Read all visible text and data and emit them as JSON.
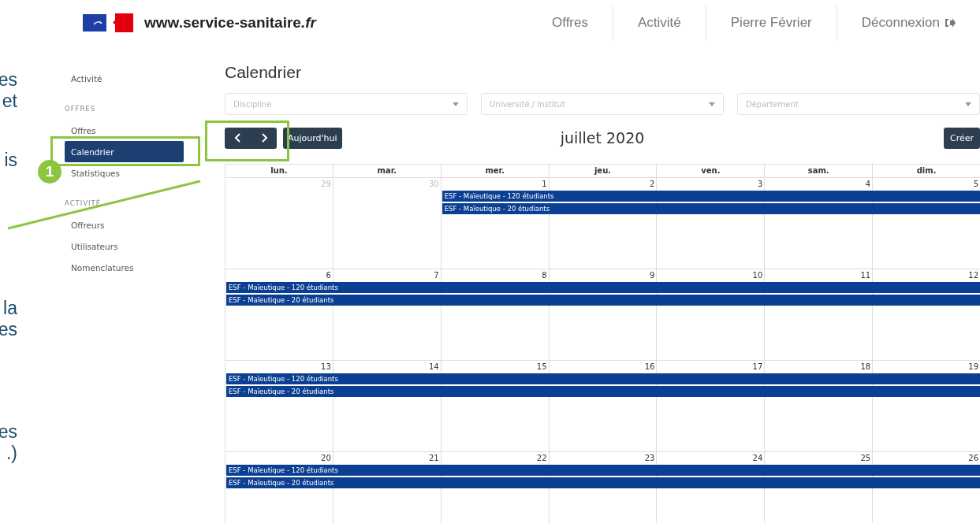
{
  "slide_text": [
    {
      "lines": [
        "es",
        "et"
      ]
    },
    {
      "lines": [
        "is"
      ]
    },
    {
      "lines": [
        "la",
        "es"
      ]
    },
    {
      "lines": [
        "es",
        ".)"
      ]
    }
  ],
  "header": {
    "site": {
      "name": "www.service-sanitaire",
      "suffix": ".fr"
    },
    "nav": [
      {
        "label": "Offres",
        "kind": "link"
      },
      {
        "label": "Activité",
        "kind": "link"
      },
      {
        "label": "Pierre Février",
        "kind": "link"
      },
      {
        "label": "Déconnexion",
        "kind": "logout"
      }
    ]
  },
  "sidebar": {
    "sections": [
      {
        "items": [
          {
            "label": "Activité",
            "selected": false
          }
        ]
      },
      {
        "heading": "OFFRES",
        "items": [
          {
            "label": "Offres",
            "selected": false
          },
          {
            "label": "Calendrier",
            "selected": true
          },
          {
            "label": "Statistiques",
            "selected": false
          }
        ]
      },
      {
        "heading": "ACTIVITÉ",
        "items": [
          {
            "label": "Offreurs",
            "selected": false
          },
          {
            "label": "Utilisateurs",
            "selected": false
          },
          {
            "label": "Nomenclatures",
            "selected": false
          }
        ]
      }
    ]
  },
  "page_title": "Calendrier",
  "filters": [
    {
      "placeholder": "Discipline"
    },
    {
      "placeholder": "Université / Institut"
    },
    {
      "placeholder": "Département"
    }
  ],
  "toolbar": {
    "today": "Aujourd'hui",
    "title": "juillet 2020",
    "create": "Créer"
  },
  "calendar": {
    "weekdays": [
      "lun.",
      "mar.",
      "mer.",
      "jeu.",
      "ven.",
      "sam.",
      "dim."
    ],
    "weeks": [
      {
        "days": [
          {
            "number": "29",
            "muted": true
          },
          {
            "number": "30",
            "muted": true
          },
          {
            "number": "1",
            "muted": false,
            "events": [
              {
                "label": "ESF - Maïeutique - 120 étudiants"
              },
              {
                "label": "ESF - Maïeutique - 20 étudiants"
              }
            ]
          },
          {
            "number": "2",
            "muted": false
          },
          {
            "number": "3",
            "muted": false
          },
          {
            "number": "4",
            "muted": false
          },
          {
            "number": "5",
            "muted": false
          }
        ]
      },
      {
        "days": [
          {
            "number": "6",
            "muted": false,
            "events": [
              {
                "label": "ESF - Maïeutique - 120 étudiants"
              },
              {
                "label": "ESF - Maïeutique - 20 étudiants"
              }
            ]
          },
          {
            "number": "7",
            "muted": false
          },
          {
            "number": "8",
            "muted": false
          },
          {
            "number": "9",
            "muted": false
          },
          {
            "number": "10",
            "muted": false
          },
          {
            "number": "11",
            "muted": false
          },
          {
            "number": "12",
            "muted": false
          }
        ]
      },
      {
        "days": [
          {
            "number": "13",
            "muted": false,
            "events": [
              {
                "label": "ESF - Maïeutique - 120 étudiants"
              },
              {
                "label": "ESF - Maïeutique - 20 étudiants"
              }
            ]
          },
          {
            "number": "14",
            "muted": false
          },
          {
            "number": "15",
            "muted": false
          },
          {
            "number": "16",
            "muted": false
          },
          {
            "number": "17",
            "muted": false
          },
          {
            "number": "18",
            "muted": false
          },
          {
            "number": "19",
            "muted": false
          }
        ]
      },
      {
        "days": [
          {
            "number": "20",
            "muted": false,
            "events": [
              {
                "label": "ESF - Maïeutique - 120 étudiants"
              },
              {
                "label": "ESF - Maïeutique - 20 étudiants"
              }
            ]
          },
          {
            "number": "21",
            "muted": false
          },
          {
            "number": "22",
            "muted": false
          },
          {
            "number": "23",
            "muted": false
          },
          {
            "number": "24",
            "muted": false
          },
          {
            "number": "25",
            "muted": false
          },
          {
            "number": "26",
            "muted": false
          }
        ]
      }
    ]
  },
  "annotation": {
    "marker": "1"
  }
}
